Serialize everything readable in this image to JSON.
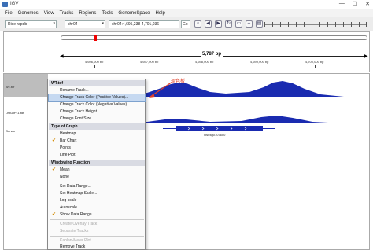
{
  "window": {
    "title": "IGV",
    "min": "—",
    "max": "☐",
    "close": "✕"
  },
  "menu": [
    "File",
    "Genomes",
    "View",
    "Tracks",
    "Regions",
    "Tools",
    "GenomeSpace",
    "Help"
  ],
  "toolbar": {
    "genome": "Rice rapdb",
    "chromosome": "chr04",
    "locus": "chr04:4,695,238-4,701,036",
    "go_label": "Go"
  },
  "ruler": {
    "span": "5,787 bp",
    "ticks": [
      "4,696,000 bp",
      "4,697,000 bp",
      "4,698,000 bp",
      "4,699,000 bp",
      "4,700,000 bp"
    ]
  },
  "tracks": [
    {
      "name": "WT.tdf"
    },
    {
      "name": "OsbZIP11.tdf"
    },
    {
      "name": "Genes"
    }
  ],
  "gene_label": "Os04g0107600",
  "annotation": "调色板",
  "context_menu": {
    "header": "WT.tdf",
    "items": [
      {
        "label": "Rename Track...",
        "type": "item"
      },
      {
        "label": "Change Track Color (Positive Values)...",
        "type": "item",
        "highlight": true
      },
      {
        "label": "Change Track Color (Negative Values)...",
        "type": "item"
      },
      {
        "label": "Change Track Height...",
        "type": "item"
      },
      {
        "label": "Change Font Size...",
        "type": "item"
      },
      {
        "label": "Type of Graph",
        "type": "header"
      },
      {
        "label": "Heatmap",
        "type": "item"
      },
      {
        "label": "Bar Chart",
        "type": "item",
        "checked": true
      },
      {
        "label": "Points",
        "type": "item"
      },
      {
        "label": "Line Plot",
        "type": "item"
      },
      {
        "label": "Windowing Function",
        "type": "header"
      },
      {
        "label": "Mean",
        "type": "item",
        "checked": true
      },
      {
        "label": "None",
        "type": "item"
      },
      {
        "label": "Set Data Range...",
        "type": "item"
      },
      {
        "label": "Set Heatmap Scale...",
        "type": "item"
      },
      {
        "label": "Log scale",
        "type": "item"
      },
      {
        "label": "Autoscale",
        "type": "item"
      },
      {
        "label": "Show Data Range",
        "type": "item",
        "checked": true
      },
      {
        "label": "Create Overlay Track",
        "type": "item",
        "disabled": true
      },
      {
        "label": "Separate Tracks",
        "type": "item",
        "disabled": true
      },
      {
        "label": "Kaplan-Meier Plot...",
        "type": "item",
        "disabled": true
      },
      {
        "label": "Remove Track",
        "type": "item"
      }
    ]
  },
  "colors": {
    "track": "#1a2bb0",
    "highlight": "#c6d9f1",
    "annotation": "#e0402a"
  }
}
